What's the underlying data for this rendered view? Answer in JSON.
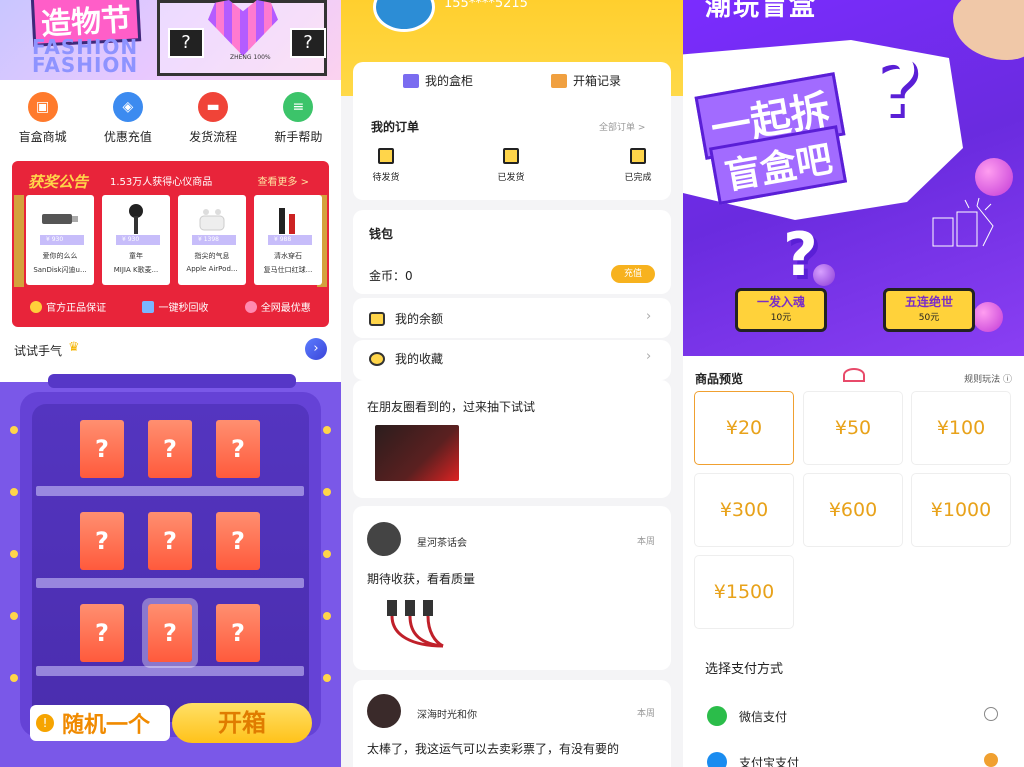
{
  "panel1": {
    "banner_title": "造物节",
    "banner_sub1": "FASHION",
    "banner_sub2": "FASHION",
    "poster_text": "ZHENG 100%",
    "icons": [
      {
        "label": "盲盒商城",
        "color": "#ff7a2c",
        "icon": "gift-icon"
      },
      {
        "label": "优惠充值",
        "color": "#3c8bf0",
        "icon": "wallet-icon"
      },
      {
        "label": "发货流程",
        "color": "#f04438",
        "icon": "truck-icon"
      },
      {
        "label": "新手帮助",
        "color": "#3cc46a",
        "icon": "doc-icon"
      }
    ],
    "notice": {
      "title": "获奖公告",
      "subtitle": "1.53万人获得心仪商品",
      "more": "查看更多 >",
      "products": [
        {
          "price": "¥ 930",
          "line1": "爱你的么么",
          "line2": "SanDisk闪迪u..."
        },
        {
          "price": "¥ 930",
          "line1": "童年",
          "line2": "MIJIA K歌麦..."
        },
        {
          "price": "¥ 1398",
          "line1": "指尖的气息",
          "line2": "Apple AirPod..."
        },
        {
          "price": "¥ 988",
          "line1": "清水穿石",
          "line2": "复马仕口红球..."
        }
      ],
      "guarantees": [
        "官方正品保证",
        "一键秒回收",
        "全网最优惠"
      ]
    },
    "try_label": "试试手气",
    "random_btn": "随机一个",
    "open_btn": "开箱",
    "box_mark": "?"
  },
  "panel2": {
    "phone": "155****5215",
    "cabinet": "我的盒柜",
    "records": "开箱记录",
    "orders_title": "我的订单",
    "all_orders": "全部订单 >",
    "order_states": [
      "待发货",
      "已发货",
      "已完成"
    ],
    "wallet_title": "钱包",
    "coins": "金币：0",
    "recharge": "充值",
    "balance": "我的余额",
    "favorites": "我的收藏",
    "posts": [
      {
        "name": "",
        "when": "",
        "msg": "在朋友圈看到的，过来抽下试试"
      },
      {
        "name": "星河茶话会",
        "when": "本周",
        "msg": "期待收获，看看质量"
      },
      {
        "name": "深海时光和你",
        "when": "本周",
        "msg": "太棒了，我这运气可以去卖彩票了，有没有要的"
      }
    ]
  },
  "panel3": {
    "top_title": "潮玩盲盒",
    "slogan1": "一起拆",
    "slogan2": "盲盒吧",
    "tiers": [
      {
        "title": "一发入魂",
        "price": "10元"
      },
      {
        "title": "五连绝世",
        "price": "50元"
      }
    ],
    "section": "商品预览",
    "rule": "规则玩法 ⓘ",
    "amounts": [
      "¥20",
      "¥50",
      "¥100",
      "¥300",
      "¥600",
      "¥1000",
      "¥1500"
    ],
    "selected_amount": "¥20",
    "pay_title": "选择支付方式",
    "pay_methods": [
      {
        "label": "微信支付",
        "color": "#2bbd4a",
        "selected": false
      },
      {
        "label": "支付宝支付",
        "color": "#1a8cf0",
        "selected": true
      }
    ]
  }
}
